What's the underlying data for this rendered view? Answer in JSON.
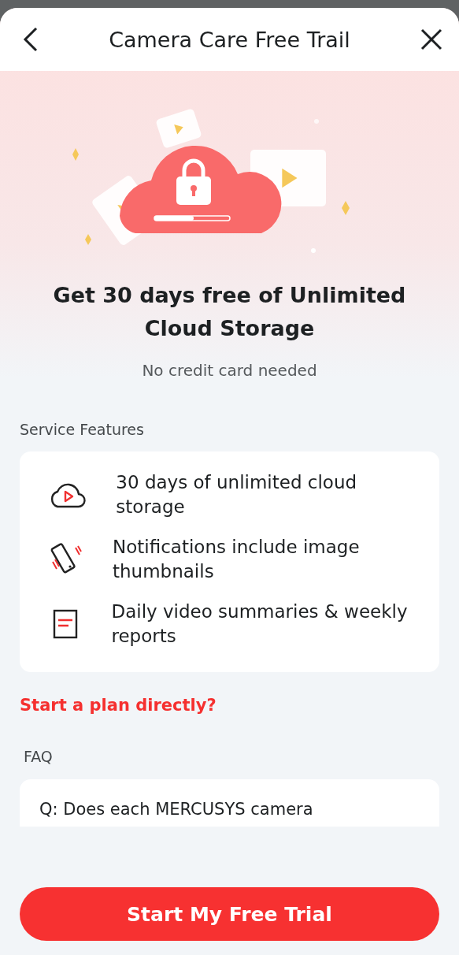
{
  "header": {
    "title": "Camera Care Free Trail"
  },
  "hero": {
    "title": "Get 30 days free of Unlimited Cloud Storage",
    "subtitle": "No credit card needed"
  },
  "features": {
    "heading": "Service Features",
    "items": [
      {
        "kind": "cloud",
        "text": "30 days of unlimited cloud storage"
      },
      {
        "kind": "phone",
        "text": "Notifications include image thumbnails"
      },
      {
        "kind": "report",
        "text": "Daily video summaries & weekly reports"
      }
    ]
  },
  "plan_link": "Start a plan directly?",
  "faq": {
    "heading": "FAQ",
    "items": [
      "Q: Does each MERCUSYS camera"
    ]
  },
  "cta": "Start My Free Trial"
}
